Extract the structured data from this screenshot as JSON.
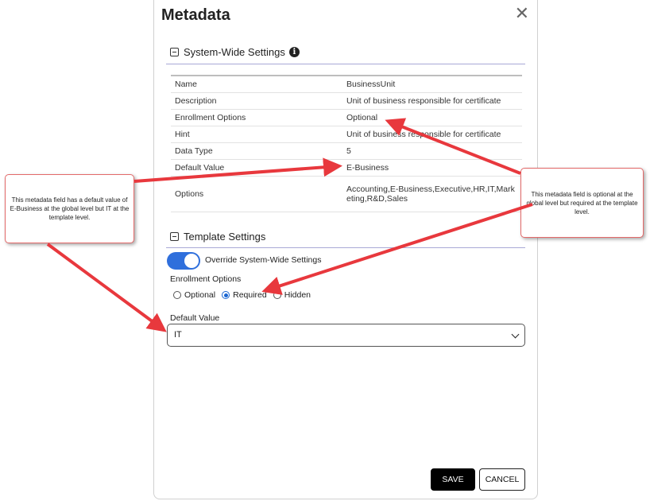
{
  "dialog": {
    "title": "Metadata",
    "close_glyph": "✕",
    "close_icon": "close-icon"
  },
  "system_section": {
    "title": "System-Wide Settings",
    "info_glyph": "i",
    "rows": [
      {
        "label": "Name",
        "value": "BusinessUnit"
      },
      {
        "label": "Description",
        "value": "Unit of business responsible for certificate"
      },
      {
        "label": "Enrollment Options",
        "value": "Optional"
      },
      {
        "label": "Hint",
        "value": "Unit of business responsible for certificate"
      },
      {
        "label": "Data Type",
        "value": "5"
      },
      {
        "label": "Default Value",
        "value": "E-Business"
      },
      {
        "label": "Options",
        "value": "Accounting,E-Business,Executive,HR,IT,Marketing,R&D,Sales"
      }
    ]
  },
  "template_section": {
    "title": "Template Settings",
    "override_label": "Override System-Wide Settings",
    "override_on": true,
    "enrollment_label": "Enrollment Options",
    "enrollment_options": [
      "Optional",
      "Required",
      "Hidden"
    ],
    "enrollment_selected": "Required",
    "default_label": "Default Value",
    "default_selected": "IT"
  },
  "buttons": {
    "save": "SAVE",
    "cancel": "CANCEL"
  },
  "callouts": {
    "left": "This metadata field has a default value of E-Business at the global level but IT at the template level.",
    "right": "This metadata field is optional at the global level but required at the template level."
  },
  "colors": {
    "accent": "#2f6fdc",
    "arrow": "#e8383d",
    "save_bg": "#000000"
  }
}
